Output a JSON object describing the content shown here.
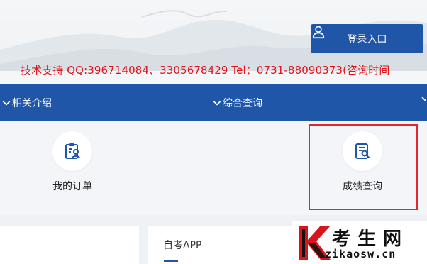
{
  "header": {
    "login_label": "登录入口",
    "support_text": "技术支持 QQ:396714084、3305678429 Tel：0731-88090373(咨询时间"
  },
  "nav": {
    "items": [
      {
        "label": "相关介绍",
        "icon": "chevron-down-icon"
      },
      {
        "label": "综合查询",
        "icon": "chevron-down-icon"
      }
    ]
  },
  "tiles": [
    {
      "label": "我的订单",
      "icon": "clipboard-user-icon"
    },
    {
      "label": "成绩查询",
      "icon": "document-search-icon"
    }
  ],
  "section": {
    "app_title": "自考APP"
  },
  "logo": {
    "cn_text": "考生网",
    "url_text": "zikaosw.cn"
  },
  "colors": {
    "brand_blue": "#1f56a8",
    "support_red": "#e0141c",
    "highlight_red": "#e3262b",
    "logo_red": "#d8141c"
  }
}
